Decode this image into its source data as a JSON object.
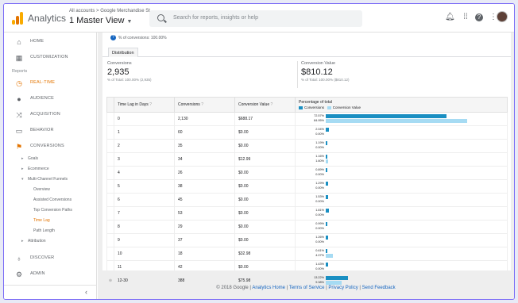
{
  "app": {
    "title": "Analytics",
    "logo_colors": [
      "#f9ab00",
      "#e37400",
      "#f9ab00"
    ]
  },
  "account": {
    "breadcrumb": "All accounts > Google Merchandise St...",
    "view": "1 Master View"
  },
  "search": {
    "placeholder": "Search for reports, insights or help"
  },
  "topbar_icons": [
    "bell-icon",
    "apps-grid-icon",
    "help-icon",
    "more-vert-icon"
  ],
  "sidebar": {
    "items": [
      {
        "label": "HOME",
        "icon": "home-icon"
      },
      {
        "label": "CUSTOMIZATION",
        "icon": "dashboard-icon"
      }
    ],
    "reports_label": "Reports",
    "report_items": [
      {
        "label": "REAL-TIME",
        "icon": "clock-icon"
      },
      {
        "label": "AUDIENCE",
        "icon": "person-icon"
      },
      {
        "label": "ACQUISITION",
        "icon": "acquisition-icon"
      },
      {
        "label": "BEHAVIOR",
        "icon": "behavior-icon"
      },
      {
        "label": "CONVERSIONS",
        "icon": "flag-icon"
      }
    ],
    "conversion_subs": [
      "Goals",
      "Ecommerce",
      "Multi-Channel Funnels"
    ],
    "mcf_subs": [
      "Overview",
      "Assisted Conversions",
      "Top Conversion Paths",
      "Time Lag",
      "Path Length"
    ],
    "attribution": "Attribution",
    "bottom_items": [
      {
        "label": "DISCOVER",
        "icon": "lightbulb-icon"
      },
      {
        "label": "ADMIN",
        "icon": "gear-icon"
      }
    ],
    "collapse_icon": "chevron-left-icon"
  },
  "report": {
    "pct_note": "% of conversions: 100.00%",
    "tab": "Distribution",
    "kpis": [
      {
        "label": "Conversions",
        "value": "2,935",
        "sub": "% of Total: 100.00% (2,935)"
      },
      {
        "label": "Conversion Value",
        "value": "$810.12",
        "sub": "% of Total: 100.00% ($810.12)"
      }
    ],
    "columns": [
      "Time Lag in Days",
      "Conversions",
      "Conversion Value",
      "Percentage of total"
    ],
    "legend": [
      {
        "label": "Conversions",
        "color": "#1a8fc2"
      },
      {
        "label": "Conversion Value",
        "color": "#a6dbf3"
      }
    ],
    "rows": [
      {
        "lag": "0",
        "conv": "2,130",
        "value": "$688.17",
        "p1": "72.57%",
        "p2": "84.95%",
        "f1": 0.7257,
        "f2": 0.8495
      },
      {
        "lag": "1",
        "conv": "60",
        "value": "$0.00",
        "p1": "2.04%",
        "p2": "0.00%",
        "f1": 0.0204,
        "f2": 0
      },
      {
        "lag": "2",
        "conv": "35",
        "value": "$0.00",
        "p1": "1.19%",
        "p2": "0.00%",
        "f1": 0.0119,
        "f2": 0
      },
      {
        "lag": "3",
        "conv": "34",
        "value": "$12.99",
        "p1": "1.16%",
        "p2": "1.60%",
        "f1": 0.0116,
        "f2": 0.016
      },
      {
        "lag": "4",
        "conv": "26",
        "value": "$0.00",
        "p1": "0.89%",
        "p2": "0.00%",
        "f1": 0.0089,
        "f2": 0
      },
      {
        "lag": "5",
        "conv": "38",
        "value": "$0.00",
        "p1": "1.29%",
        "p2": "0.00%",
        "f1": 0.0129,
        "f2": 0
      },
      {
        "lag": "6",
        "conv": "45",
        "value": "$0.00",
        "p1": "1.53%",
        "p2": "0.00%",
        "f1": 0.0153,
        "f2": 0
      },
      {
        "lag": "7",
        "conv": "53",
        "value": "$0.00",
        "p1": "1.81%",
        "p2": "0.00%",
        "f1": 0.0181,
        "f2": 0
      },
      {
        "lag": "8",
        "conv": "29",
        "value": "$0.00",
        "p1": "0.99%",
        "p2": "0.00%",
        "f1": 0.0099,
        "f2": 0
      },
      {
        "lag": "9",
        "conv": "37",
        "value": "$0.00",
        "p1": "1.26%",
        "p2": "0.00%",
        "f1": 0.0126,
        "f2": 0
      },
      {
        "lag": "10",
        "conv": "18",
        "value": "$32.98",
        "p1": "0.61%",
        "p2": "4.07%",
        "f1": 0.0061,
        "f2": 0.0407
      },
      {
        "lag": "11",
        "conv": "42",
        "value": "$0.00",
        "p1": "1.43%",
        "p2": "0.00%",
        "f1": 0.0143,
        "f2": 0
      },
      {
        "lag": "12-30",
        "conv": "388",
        "value": "$75.98",
        "p1": "13.22%",
        "p2": "9.38%",
        "f1": 0.1322,
        "f2": 0.0938
      }
    ]
  },
  "footer": {
    "copyright": "© 2018 Google |",
    "links": [
      "Analytics Home",
      "Terms of Service",
      "Privacy Policy",
      "Send Feedback"
    ]
  }
}
